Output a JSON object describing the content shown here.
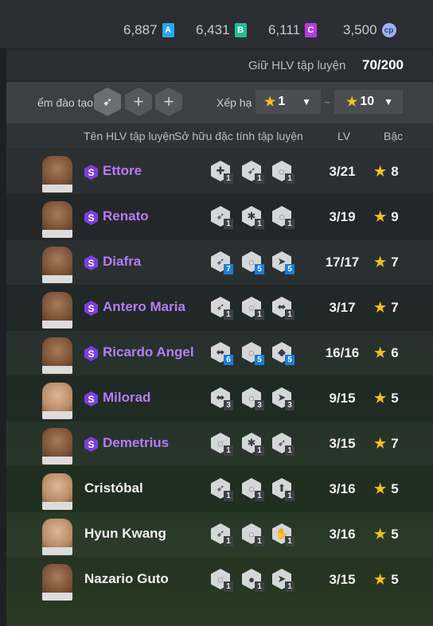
{
  "currency": [
    {
      "value": "6,887",
      "badge": "A",
      "color": "#2aa8e8",
      "icon": "a-currency-icon"
    },
    {
      "value": "6,431",
      "badge": "B",
      "color": "#1fbf9a",
      "icon": "b-currency-icon"
    },
    {
      "value": "6,111",
      "badge": "C",
      "color": "#b63ce6",
      "icon": "c-currency-icon"
    },
    {
      "value": "3,500",
      "badge": "cp",
      "color": "#9fb2f0",
      "icon": "cp-coin-icon"
    }
  ],
  "hold": {
    "label": "Giữ HLV tập luyện",
    "value": "70/200"
  },
  "filter": {
    "training_label": "ểm đào tạo",
    "rank_label": "Xếp hạ",
    "rank_min": "1",
    "rank_max": "10",
    "separator": "~",
    "add_symbol": "+"
  },
  "columns": {
    "name": "Tên HLV tập luyện",
    "traits": "Sở hữu đặc tính tập luyện",
    "lv": "LV",
    "rank": "Bậc"
  },
  "coaches": [
    {
      "name": "Ettore",
      "special": true,
      "lv": "3/21",
      "rank": "8",
      "skin": "dark",
      "traits": [
        {
          "icon": "fitness-trait-icon",
          "n": "1",
          "hi": false
        },
        {
          "icon": "sprint-trait-icon",
          "n": "1",
          "hi": false
        },
        {
          "icon": "dribble-trait-icon",
          "n": "1",
          "hi": false
        }
      ]
    },
    {
      "name": "Renato",
      "special": true,
      "lv": "3/19",
      "rank": "9",
      "skin": "dark",
      "traits": [
        {
          "icon": "sprint-trait-icon",
          "n": "1",
          "hi": false
        },
        {
          "icon": "tactics-trait-icon",
          "n": "1",
          "hi": false
        },
        {
          "icon": "dribble-trait-icon",
          "n": "1",
          "hi": false
        }
      ]
    },
    {
      "name": "Diafra",
      "special": true,
      "lv": "17/17",
      "rank": "7",
      "skin": "dark",
      "traits": [
        {
          "icon": "sprint-trait-icon",
          "n": "7",
          "hi": true
        },
        {
          "icon": "dribble-trait-icon",
          "n": "5",
          "hi": true
        },
        {
          "icon": "shooting-trait-icon",
          "n": "5",
          "hi": true
        }
      ]
    },
    {
      "name": "Antero Maria",
      "special": true,
      "lv": "3/17",
      "rank": "7",
      "skin": "dark",
      "traits": [
        {
          "icon": "sprint-trait-icon",
          "n": "1",
          "hi": false
        },
        {
          "icon": "dribble-trait-icon",
          "n": "1",
          "hi": false
        },
        {
          "icon": "passing-trait-icon",
          "n": "1",
          "hi": false
        }
      ]
    },
    {
      "name": "Ricardo Angel",
      "special": true,
      "lv": "16/16",
      "rank": "6",
      "skin": "dark",
      "traits": [
        {
          "icon": "passing-trait-icon",
          "n": "6",
          "hi": true
        },
        {
          "icon": "dribble-trait-icon",
          "n": "5",
          "hi": true
        },
        {
          "icon": "defending-trait-icon",
          "n": "5",
          "hi": true
        }
      ]
    },
    {
      "name": "Milorad",
      "special": true,
      "lv": "9/15",
      "rank": "5",
      "skin": "light",
      "traits": [
        {
          "icon": "passing-trait-icon",
          "n": "3",
          "hi": false
        },
        {
          "icon": "dribble-trait-icon",
          "n": "3",
          "hi": false
        },
        {
          "icon": "shooting-trait-icon",
          "n": "3",
          "hi": false
        }
      ]
    },
    {
      "name": "Demetrius",
      "special": true,
      "lv": "3/15",
      "rank": "7",
      "skin": "dark",
      "traits": [
        {
          "icon": "dribble-trait-icon",
          "n": "1",
          "hi": false
        },
        {
          "icon": "tactics-trait-icon",
          "n": "1",
          "hi": false
        },
        {
          "icon": "sprint-trait-icon",
          "n": "1",
          "hi": false
        }
      ]
    },
    {
      "name": "Cristóbal",
      "special": false,
      "lv": "3/16",
      "rank": "5",
      "skin": "light",
      "traits": [
        {
          "icon": "sprint-trait-icon",
          "n": "1",
          "hi": false
        },
        {
          "icon": "dribble-trait-icon",
          "n": "1",
          "hi": false
        },
        {
          "icon": "jump-trait-icon",
          "n": "1",
          "hi": false
        }
      ]
    },
    {
      "name": "Hyun Kwang",
      "special": false,
      "lv": "3/16",
      "rank": "5",
      "skin": "light",
      "traits": [
        {
          "icon": "sprint-trait-icon",
          "n": "1",
          "hi": false
        },
        {
          "icon": "dribble-trait-icon",
          "n": "1",
          "hi": false
        },
        {
          "icon": "goalkeeper-trait-icon",
          "n": "1",
          "hi": false
        }
      ]
    },
    {
      "name": "Nazario Guto",
      "special": false,
      "lv": "3/15",
      "rank": "5",
      "skin": "dark",
      "traits": [
        {
          "icon": "dribble-trait-icon",
          "n": "1",
          "hi": false
        },
        {
          "icon": "header-trait-icon",
          "n": "1",
          "hi": false
        },
        {
          "icon": "shooting-trait-icon",
          "n": "1",
          "hi": false
        }
      ]
    }
  ],
  "icon_glyphs": {
    "fitness-trait-icon": "✚",
    "sprint-trait-icon": "➶",
    "dribble-trait-icon": "◌",
    "tactics-trait-icon": "✱",
    "shooting-trait-icon": "➤",
    "passing-trait-icon": "⬌",
    "defending-trait-icon": "◆",
    "jump-trait-icon": "⬆",
    "goalkeeper-trait-icon": "✋",
    "header-trait-icon": "●"
  },
  "star": "★"
}
